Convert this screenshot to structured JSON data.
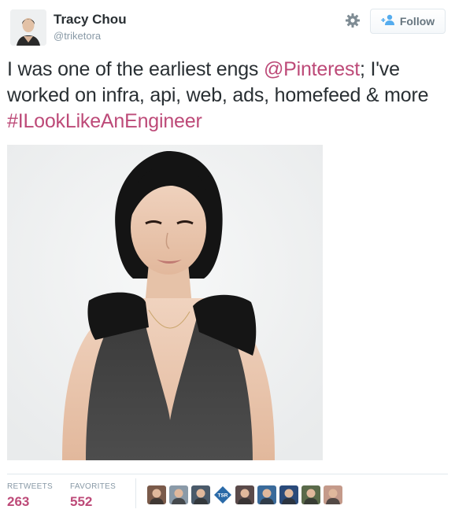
{
  "author": {
    "name": "Tracy Chou",
    "handle": "@triketora"
  },
  "follow_button": {
    "label": "Follow",
    "icon": "person-plus-icon"
  },
  "settings_icon": "gear-icon",
  "tweet": {
    "text_part_1": "I was one of the earliest engs ",
    "mention": "@Pinterest",
    "text_part_2": "; I've worked on infra, api, web, ads, homefeed & more ",
    "hashtag": "#ILookLikeAnEngineer"
  },
  "stats": {
    "retweets_label": "RETWEETS",
    "retweets_count": "263",
    "favorites_label": "FAVORITES",
    "favorites_count": "552"
  },
  "favoriter_avatars": [
    {
      "kind": "face",
      "bg": "#7a5a4a"
    },
    {
      "kind": "face",
      "bg": "#8a9aa8"
    },
    {
      "kind": "face",
      "bg": "#4a5a6a"
    },
    {
      "kind": "logo",
      "bg": "#2a6aa8",
      "text": "TSR"
    },
    {
      "kind": "face",
      "bg": "#5a4a4a"
    },
    {
      "kind": "face",
      "bg": "#3a6a9a"
    },
    {
      "kind": "face",
      "bg": "#2a4a7a"
    },
    {
      "kind": "face",
      "bg": "#5a6a4a"
    },
    {
      "kind": "face",
      "bg": "#c49a8a"
    }
  ],
  "colors": {
    "link": "#bd4a78",
    "text": "#292f33",
    "muted": "#8899a6",
    "follow_icon": "#55acee"
  }
}
